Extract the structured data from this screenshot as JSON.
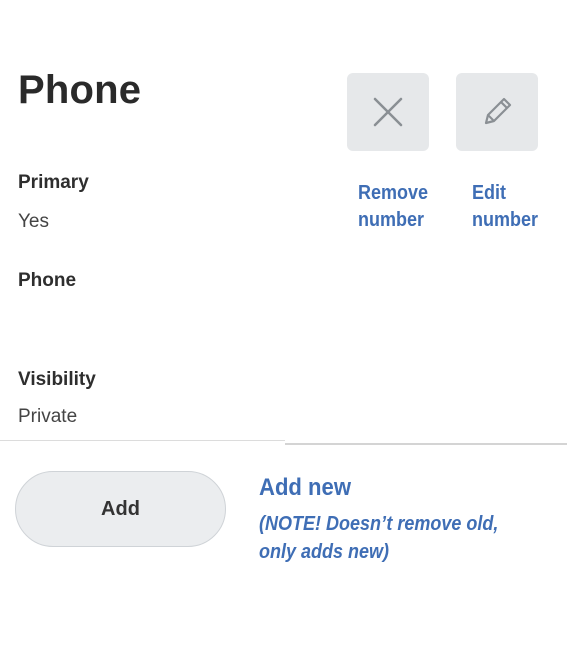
{
  "section": {
    "title": "Phone"
  },
  "actions": {
    "remove_icon": "close-icon",
    "edit_icon": "pencil-icon"
  },
  "annotations": {
    "remove": [
      "Remove",
      "number"
    ],
    "edit": [
      "Edit",
      "number"
    ],
    "add_title": "Add new",
    "add_note": [
      "(NOTE! Doesn’t remove old,",
      "only adds new)"
    ],
    "color": "#3f6eb5"
  },
  "fields": {
    "primary": {
      "label": "Primary",
      "value": "Yes"
    },
    "phone": {
      "label": "Phone",
      "value": ""
    },
    "visibility": {
      "label": "Visibility",
      "value": "Private"
    }
  },
  "add_button": {
    "label": "Add"
  }
}
